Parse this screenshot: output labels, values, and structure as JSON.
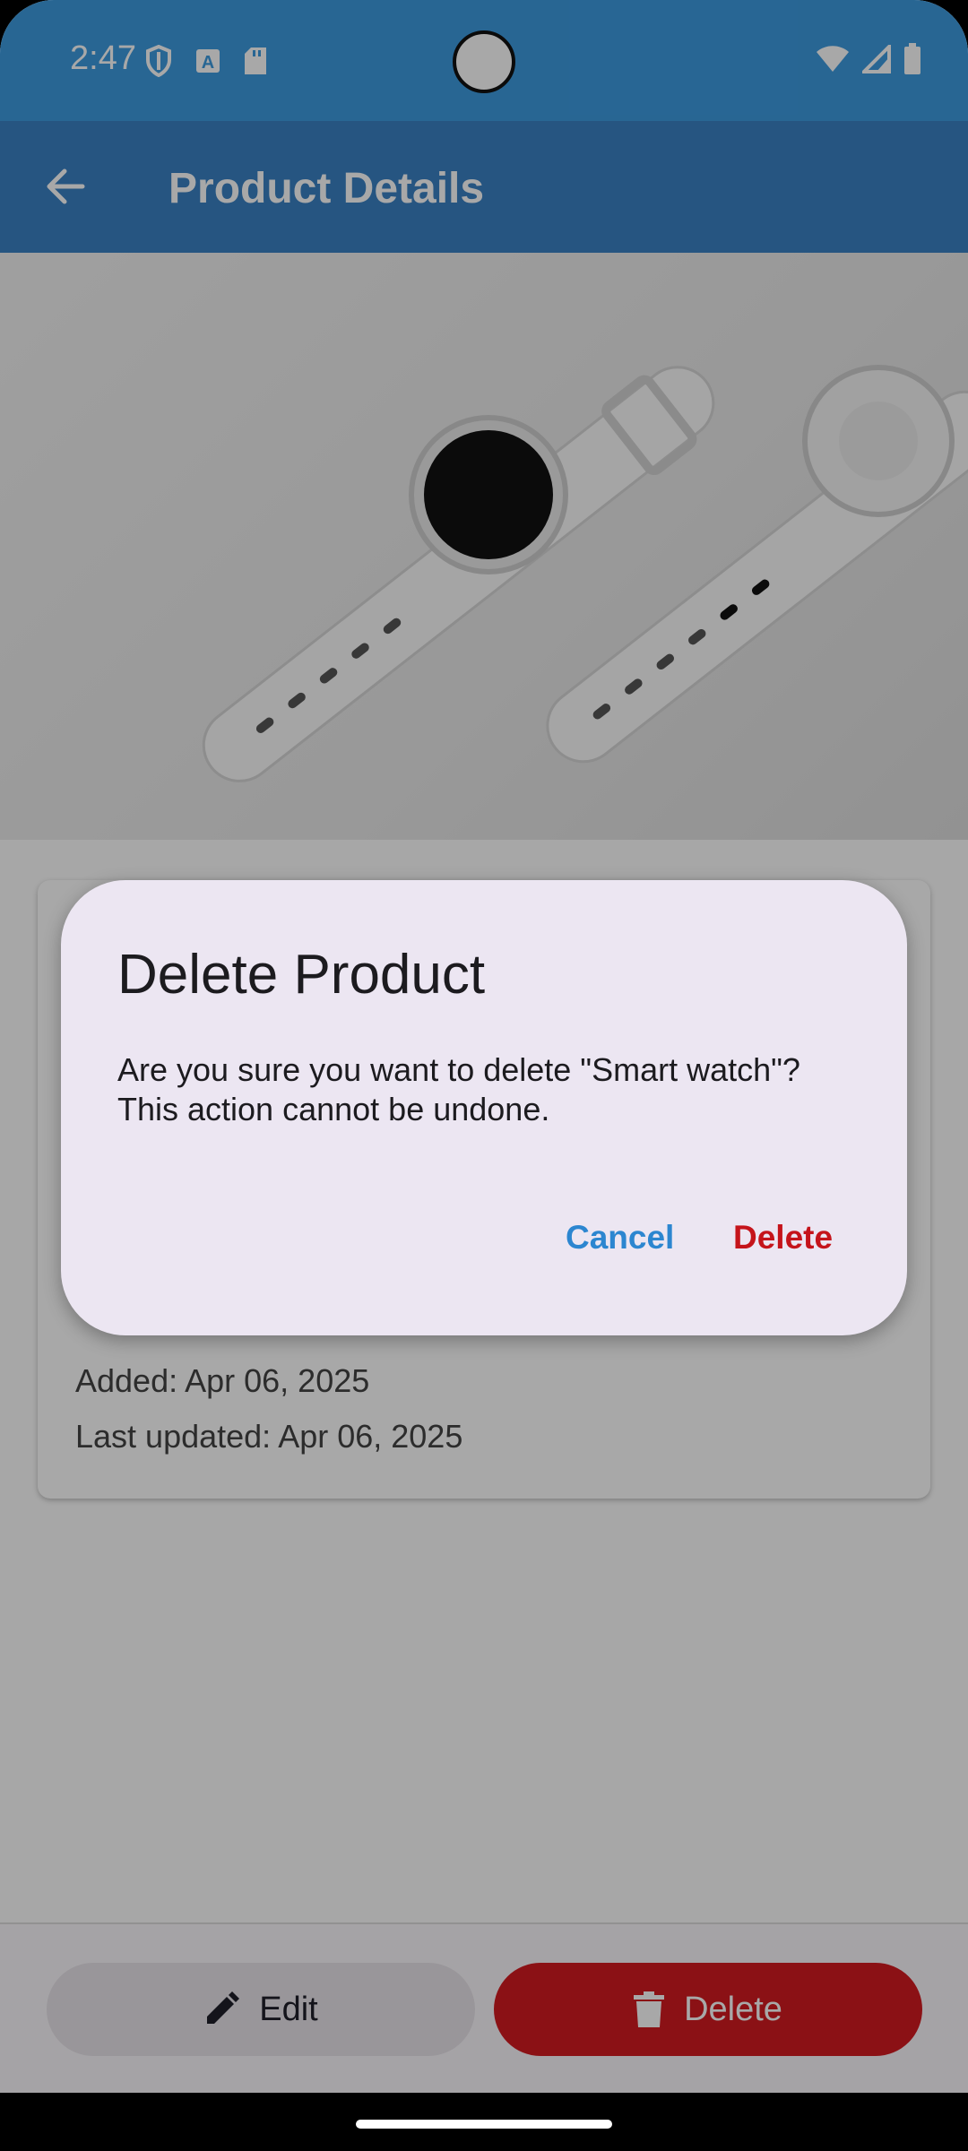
{
  "status_bar": {
    "time": "2:47",
    "icons_left": [
      "shield-icon",
      "text-a-icon",
      "sd-card-icon"
    ],
    "icons_right": [
      "wifi-icon",
      "signal-icon",
      "battery-icon"
    ]
  },
  "app_bar": {
    "title": "Product Details",
    "back_icon": "arrow-back-icon",
    "color": "#3a82c4"
  },
  "product": {
    "image_subject": "two smart watches"
  },
  "info_card": {
    "added": "Added: Apr 06, 2025",
    "last_updated": "Last updated: Apr 06, 2025"
  },
  "bottom_bar": {
    "edit_label": "Edit",
    "edit_icon": "pencil-icon",
    "delete_label": "Delete",
    "delete_icon": "trash-icon",
    "delete_color": "#d31a21"
  },
  "dialog": {
    "title": "Delete Product",
    "body_line1": "Are you sure you want to delete \"Smart watch\"?",
    "body_line2": "This action cannot be undone.",
    "cancel_label": "Cancel",
    "delete_label": "Delete",
    "cancel_color": "#2c86d0",
    "delete_color": "#c5141b"
  }
}
